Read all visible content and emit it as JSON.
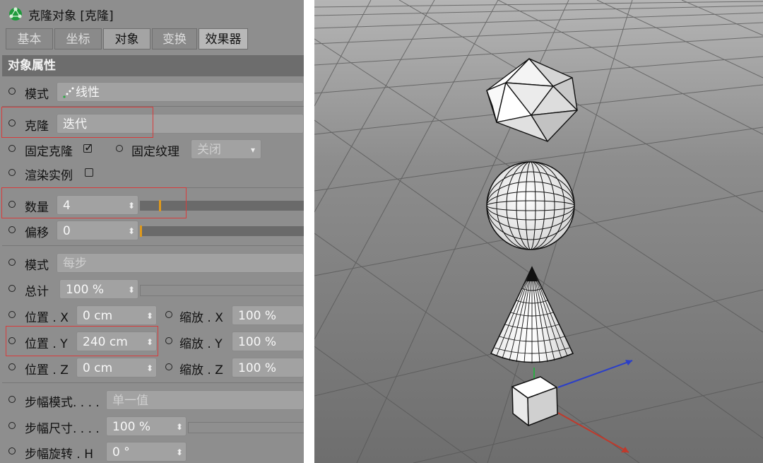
{
  "window": {
    "title": "克隆对象 [克隆]",
    "icon": "cloner-icon"
  },
  "tabs": [
    {
      "label": "基本",
      "state": "inactive"
    },
    {
      "label": "坐标",
      "state": "inactive"
    },
    {
      "label": "对象",
      "state": "active"
    },
    {
      "label": "变换",
      "state": "inactive"
    },
    {
      "label": "效果器",
      "state": "highlight"
    }
  ],
  "section": {
    "title": "对象属性"
  },
  "props": {
    "mode": {
      "label": "模式",
      "value": "线性",
      "icon": "linear-dots-icon"
    },
    "clone": {
      "label": "克隆",
      "value": "迭代"
    },
    "fix_clone": {
      "label": "固定克隆",
      "checked": true
    },
    "fix_texture": {
      "label": "固定纹理",
      "value": "关闭"
    },
    "render_instance": {
      "label": "渲染实例",
      "checked": false
    },
    "count": {
      "label": "数量",
      "value": "4",
      "fraction": 0.12
    },
    "offset": {
      "label": "偏移",
      "value": "0",
      "fraction": 0.0
    },
    "mode2": {
      "label": "模式",
      "value": "每步"
    },
    "total": {
      "label": "总计",
      "value": "100 %"
    },
    "pos_x": {
      "label": "位置 . X",
      "value": "0 cm"
    },
    "pos_y": {
      "label": "位置 . Y",
      "value": "240 cm"
    },
    "pos_z": {
      "label": "位置 . Z",
      "value": "0 cm"
    },
    "scale_x": {
      "label": "缩放 . X",
      "value": "100 %"
    },
    "scale_y": {
      "label": "缩放 . Y",
      "value": "100 %"
    },
    "scale_z": {
      "label": "缩放 . Z",
      "value": "100 %"
    },
    "step_mode": {
      "label": "步幅模式. . . .",
      "value": "单一值"
    },
    "step_size": {
      "label": "步幅尺寸. . . .",
      "value": "100 %"
    },
    "step_rot": {
      "label": "步幅旋转 . H",
      "value": "0 °"
    }
  },
  "colors": {
    "panel_bg": "#8e8e8e",
    "highlight_box": "#d83c3c",
    "slider_tick": "#e09a1b",
    "viewport_bg": "#7b7b7b",
    "axis_x": "#c0392b",
    "axis_y": "#2eaa46",
    "axis_z": "#2b3fc8"
  },
  "viewport": {
    "objects": [
      "icosahedron",
      "sphere",
      "cone",
      "cube"
    ]
  }
}
